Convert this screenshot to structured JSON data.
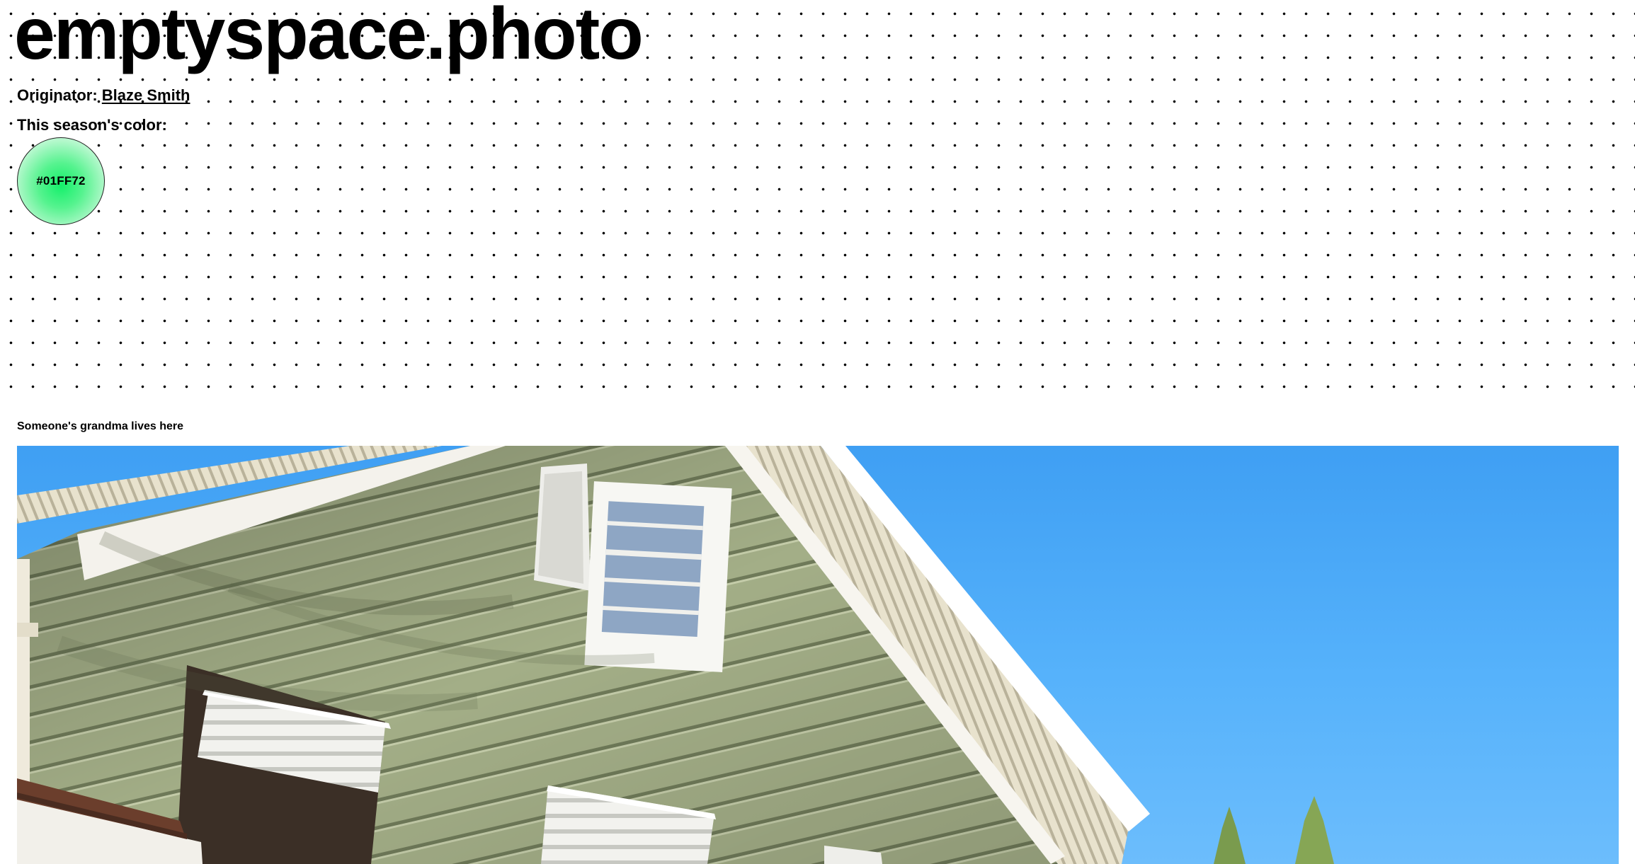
{
  "site": {
    "title": "emptyspace.photo"
  },
  "originator": {
    "label": "Originator:",
    "name": "Blaze Smith"
  },
  "season_color": {
    "label": "This season's color:",
    "hex": "#01FF72"
  },
  "photo": {
    "caption": "Someone's grandma lives here"
  }
}
